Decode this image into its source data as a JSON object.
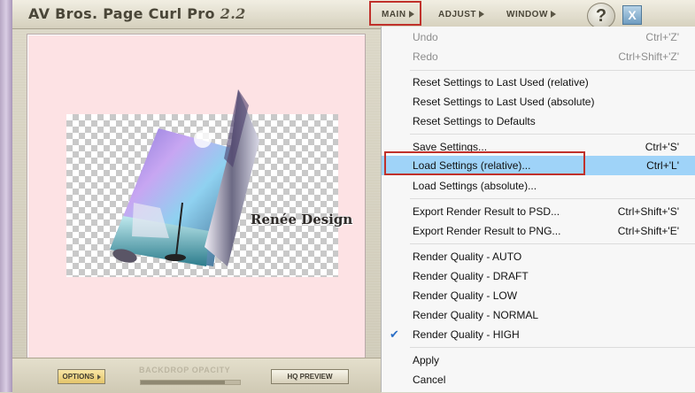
{
  "window": {
    "title": "AV Bros. Page Curl Pro",
    "version": "2.2",
    "menus": [
      {
        "label": "MAIN"
      },
      {
        "label": "ADJUST"
      },
      {
        "label": "WINDOW"
      }
    ],
    "help_label": "?",
    "close_label": "X"
  },
  "canvas": {
    "watermark": "Renée Design"
  },
  "bottom_bar": {
    "options_label": "OPTIONS",
    "backdrop_opacity_label": "BACKDROP OPACITY",
    "backdrop_opacity_level_pct": 85,
    "hq_preview_label": "HQ PREVIEW"
  },
  "main_menu": {
    "items": [
      {
        "label": "Undo",
        "shortcut": "Ctrl+'Z'",
        "enabled": false
      },
      {
        "label": "Redo",
        "shortcut": "Ctrl+Shift+'Z'",
        "enabled": false
      },
      {
        "label": "Reset Settings to Last Used (relative)",
        "shortcut": ""
      },
      {
        "label": "Reset Settings to Last Used (absolute)",
        "shortcut": ""
      },
      {
        "label": "Reset Settings to Defaults",
        "shortcut": ""
      },
      {
        "label": "Save Settings...",
        "shortcut": "Ctrl+'S'"
      },
      {
        "label": "Load Settings (relative)...",
        "shortcut": "Ctrl+'L'",
        "selected": true
      },
      {
        "label": "Load Settings (absolute)...",
        "shortcut": ""
      },
      {
        "label": "Export Render Result to PSD...",
        "shortcut": "Ctrl+Shift+'S'"
      },
      {
        "label": "Export Render Result to PNG...",
        "shortcut": "Ctrl+Shift+'E'"
      },
      {
        "label": "Render Quality - AUTO",
        "shortcut": ""
      },
      {
        "label": "Render Quality - DRAFT",
        "shortcut": ""
      },
      {
        "label": "Render Quality - LOW",
        "shortcut": ""
      },
      {
        "label": "Render Quality - NORMAL",
        "shortcut": ""
      },
      {
        "label": "Render Quality - HIGH",
        "shortcut": "",
        "checked": true
      },
      {
        "label": "Apply",
        "shortcut": ""
      },
      {
        "label": "Cancel",
        "shortcut": ""
      }
    ]
  },
  "colors": {
    "highlight_box": "#c0312b",
    "menu_selected": "#9fd3f8",
    "canvas_bg": "#fde2e4"
  }
}
